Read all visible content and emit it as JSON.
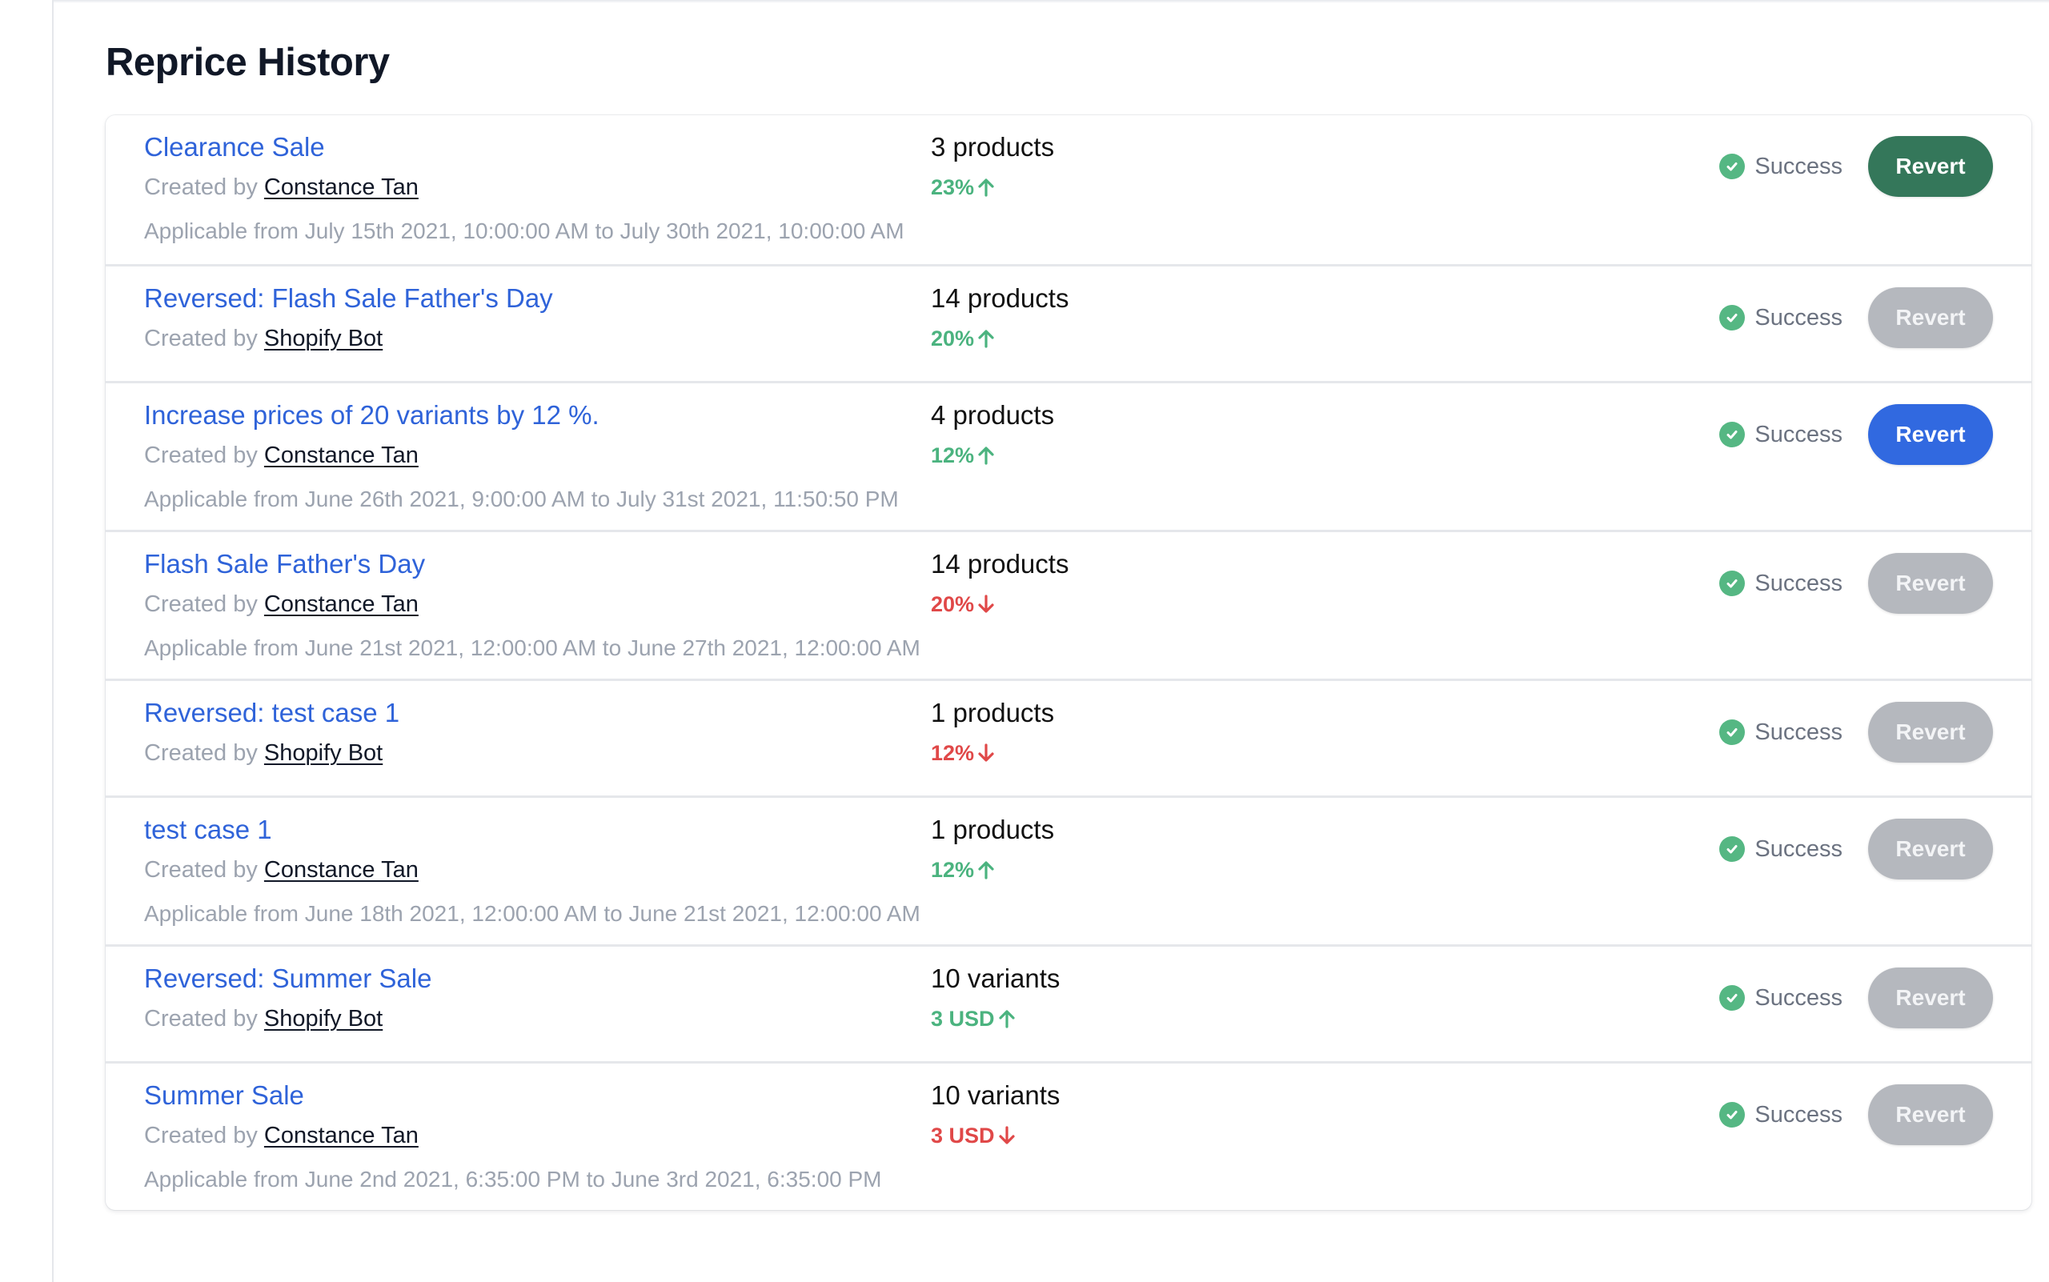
{
  "page": {
    "title": "Reprice History"
  },
  "colors": {
    "link": "#2f63d9",
    "increase": "#4bb37f",
    "decrease": "#e04848",
    "success": "#55b783",
    "revert_green": "#34775a",
    "revert_blue": "#3169e0",
    "revert_disabled": "#b5b8be"
  },
  "labels": {
    "created_by": "Created by ",
    "revert": "Revert"
  },
  "history": [
    {
      "title": "Clearance Sale",
      "creator": "Constance Tan",
      "count": "3 products",
      "change": "23%",
      "direction": "up",
      "applicable": "Applicable from July 15th 2021, 10:00:00 AM to July 30th 2021, 10:00:00 AM",
      "status": "Success",
      "status_icon": "check-circle-icon",
      "revert_label": "Revert",
      "revert_state": "green"
    },
    {
      "title": "Reversed: Flash Sale Father's Day",
      "creator": "Shopify Bot",
      "count": "14 products",
      "change": "20%",
      "direction": "up",
      "applicable": null,
      "status": "Success",
      "status_icon": "check-circle-icon",
      "revert_label": "Revert",
      "revert_state": "disabled"
    },
    {
      "title": "Increase prices of 20 variants by 12 %.",
      "creator": "Constance Tan",
      "count": "4 products",
      "change": "12%",
      "direction": "up",
      "applicable": "Applicable from June 26th 2021, 9:00:00 AM to July 31st 2021, 11:50:50 PM",
      "status": "Success",
      "status_icon": "check-circle-icon",
      "revert_label": "Revert",
      "revert_state": "blue"
    },
    {
      "title": "Flash Sale Father's Day",
      "creator": "Constance Tan",
      "count": "14 products",
      "change": "20%",
      "direction": "down",
      "applicable": "Applicable from June 21st 2021, 12:00:00 AM to June 27th 2021, 12:00:00 AM",
      "status": "Success",
      "status_icon": "check-circle-icon",
      "revert_label": "Revert",
      "revert_state": "disabled"
    },
    {
      "title": "Reversed: test case 1",
      "creator": "Shopify Bot",
      "count": "1 products",
      "change": "12%",
      "direction": "down",
      "applicable": null,
      "status": "Success",
      "status_icon": "check-circle-icon",
      "revert_label": "Revert",
      "revert_state": "disabled"
    },
    {
      "title": "test case 1",
      "creator": "Constance Tan",
      "count": "1 products",
      "change": "12%",
      "direction": "up",
      "applicable": "Applicable from June 18th 2021, 12:00:00 AM to June 21st 2021, 12:00:00 AM",
      "status": "Success",
      "status_icon": "check-circle-icon",
      "revert_label": "Revert",
      "revert_state": "disabled"
    },
    {
      "title": "Reversed: Summer Sale",
      "creator": "Shopify Bot",
      "count": "10 variants",
      "change": "3 USD",
      "direction": "up",
      "applicable": null,
      "status": "Success",
      "status_icon": "check-circle-icon",
      "revert_label": "Revert",
      "revert_state": "disabled"
    },
    {
      "title": "Summer Sale",
      "creator": "Constance Tan",
      "count": "10 variants",
      "change": "3 USD",
      "direction": "down",
      "applicable": "Applicable from June 2nd 2021, 6:35:00 PM to June 3rd 2021, 6:35:00 PM",
      "status": "Success",
      "status_icon": "check-circle-icon",
      "revert_label": "Revert",
      "revert_state": "disabled"
    }
  ]
}
